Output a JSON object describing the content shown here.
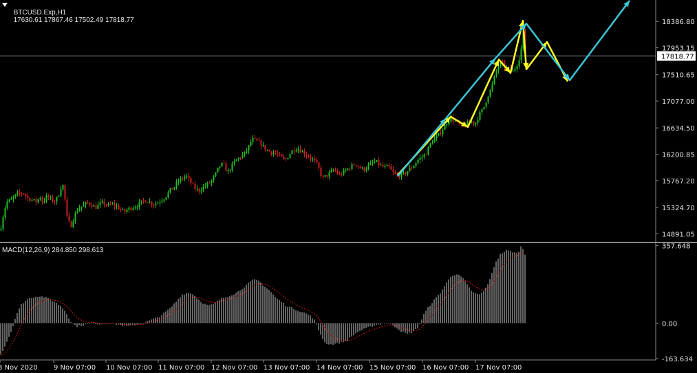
{
  "header": {
    "symbol": "BTCUSD.Exp,H1",
    "ohlc": "17630.61 17867.46 17502.49 17818.77"
  },
  "macd_header": {
    "label": "MACD(12,26,9) 284.850 298.613"
  },
  "colors": {
    "background": "#000000",
    "bull": "#1fbf1f",
    "bear": "#cc1f1f",
    "wave_primary": "#3cc7d8",
    "wave_secondary": "#ffff22",
    "histogram": "#c8c8c8",
    "signal": "#d21a1a",
    "grid": "#8a8a8a"
  },
  "chart_data": [
    {
      "type": "candlestick",
      "yticks": [
        "18386.80",
        "17953.15",
        "17510.65",
        "17077.00",
        "16634.50",
        "16200.85",
        "15767.20",
        "15324.70",
        "14891.05"
      ],
      "yrange": [
        14760,
        18740
      ],
      "current_price": "17818.77",
      "xticks": [
        "8 Nov 2020",
        "9 Nov 07:00",
        "10 Nov 07:00",
        "11 Nov 07:00",
        "12 Nov 07:00",
        "13 Nov 07:00",
        "14 Nov 07:00",
        "15 Nov 07:00",
        "16 Nov 07:00",
        "17 Nov 07:00"
      ],
      "close_path": [
        [
          0,
          14950
        ],
        [
          6,
          15300
        ],
        [
          10,
          15420
        ],
        [
          16,
          15450
        ],
        [
          22,
          15520
        ],
        [
          28,
          15560
        ],
        [
          34,
          15560
        ],
        [
          40,
          15480
        ],
        [
          46,
          15450
        ],
        [
          52,
          15420
        ],
        [
          58,
          15500
        ],
        [
          62,
          15400
        ],
        [
          66,
          15500
        ],
        [
          72,
          15480
        ],
        [
          78,
          15420
        ],
        [
          84,
          15500
        ],
        [
          88,
          15650
        ],
        [
          92,
          15700
        ],
        [
          96,
          15200
        ],
        [
          102,
          15000
        ],
        [
          108,
          15200
        ],
        [
          114,
          15320
        ],
        [
          120,
          15350
        ],
        [
          126,
          15400
        ],
        [
          132,
          15380
        ],
        [
          138,
          15320
        ],
        [
          144,
          15380
        ],
        [
          150,
          15400
        ],
        [
          156,
          15350
        ],
        [
          162,
          15380
        ],
        [
          168,
          15350
        ],
        [
          174,
          15300
        ],
        [
          180,
          15250
        ],
        [
          186,
          15300
        ],
        [
          192,
          15330
        ],
        [
          198,
          15350
        ],
        [
          204,
          15400
        ],
        [
          210,
          15450
        ],
        [
          216,
          15420
        ],
        [
          222,
          15380
        ],
        [
          228,
          15400
        ],
        [
          234,
          15450
        ],
        [
          240,
          15500
        ],
        [
          246,
          15600
        ],
        [
          252,
          15650
        ],
        [
          258,
          15750
        ],
        [
          264,
          15800
        ],
        [
          270,
          15850
        ],
        [
          276,
          15750
        ],
        [
          282,
          15650
        ],
        [
          288,
          15600
        ],
        [
          294,
          15650
        ],
        [
          300,
          15700
        ],
        [
          306,
          15750
        ],
        [
          312,
          15850
        ],
        [
          318,
          16000
        ],
        [
          324,
          16050
        ],
        [
          330,
          15900
        ],
        [
          336,
          16000
        ],
        [
          342,
          16100
        ],
        [
          348,
          16150
        ],
        [
          354,
          16200
        ],
        [
          360,
          16300
        ],
        [
          366,
          16450
        ],
        [
          372,
          16420
        ],
        [
          378,
          16380
        ],
        [
          384,
          16300
        ],
        [
          390,
          16250
        ],
        [
          396,
          16230
        ],
        [
          402,
          16200
        ],
        [
          408,
          16150
        ],
        [
          414,
          16100
        ],
        [
          420,
          16200
        ],
        [
          426,
          16280
        ],
        [
          432,
          16300
        ],
        [
          438,
          16250
        ],
        [
          444,
          16200
        ],
        [
          450,
          16150
        ],
        [
          456,
          16100
        ],
        [
          462,
          16000
        ],
        [
          468,
          15800
        ],
        [
          474,
          15850
        ],
        [
          480,
          15900
        ],
        [
          486,
          15950
        ],
        [
          492,
          15850
        ],
        [
          498,
          15900
        ],
        [
          504,
          15950
        ],
        [
          510,
          16000
        ],
        [
          516,
          16050
        ],
        [
          522,
          15980
        ],
        [
          528,
          15950
        ],
        [
          534,
          16000
        ],
        [
          540,
          16050
        ],
        [
          546,
          16080
        ],
        [
          552,
          16020
        ],
        [
          558,
          15980
        ],
        [
          564,
          16000
        ],
        [
          570,
          15900
        ],
        [
          576,
          15850
        ],
        [
          582,
          15860
        ],
        [
          588,
          15880
        ],
        [
          594,
          15950
        ],
        [
          600,
          16000
        ],
        [
          606,
          16100
        ],
        [
          612,
          16150
        ],
        [
          618,
          16200
        ],
        [
          624,
          16350
        ],
        [
          630,
          16450
        ],
        [
          636,
          16500
        ],
        [
          642,
          16600
        ],
        [
          648,
          16700
        ],
        [
          654,
          16800
        ],
        [
          660,
          16750
        ],
        [
          666,
          16700
        ],
        [
          672,
          16650
        ],
        [
          678,
          16700
        ],
        [
          684,
          16750
        ],
        [
          690,
          16700
        ],
        [
          696,
          16850
        ],
        [
          702,
          16950
        ],
        [
          708,
          17150
        ],
        [
          714,
          17300
        ],
        [
          720,
          17550
        ],
        [
          726,
          17700
        ],
        [
          732,
          17650
        ],
        [
          738,
          17600
        ],
        [
          744,
          17550
        ],
        [
          750,
          17650
        ],
        [
          756,
          17850
        ],
        [
          760,
          18200
        ],
        [
          763,
          17820
        ]
      ]
    },
    {
      "type": "macd",
      "yticks": [
        "357.648",
        "0.00",
        "-163.634"
      ],
      "yrange": [
        -170,
        362
      ],
      "hist": [
        [
          0,
          -150
        ],
        [
          8,
          -100
        ],
        [
          16,
          -40
        ],
        [
          24,
          40
        ],
        [
          32,
          90
        ],
        [
          40,
          110
        ],
        [
          48,
          120
        ],
        [
          56,
          125
        ],
        [
          64,
          120
        ],
        [
          72,
          110
        ],
        [
          80,
          95
        ],
        [
          88,
          80
        ],
        [
          96,
          50
        ],
        [
          104,
          0
        ],
        [
          112,
          -15
        ],
        [
          120,
          -10
        ],
        [
          128,
          -5
        ],
        [
          136,
          0
        ],
        [
          144,
          -5
        ],
        [
          152,
          0
        ],
        [
          160,
          0
        ],
        [
          168,
          -5
        ],
        [
          176,
          -10
        ],
        [
          184,
          -15
        ],
        [
          192,
          -10
        ],
        [
          200,
          -5
        ],
        [
          208,
          0
        ],
        [
          216,
          10
        ],
        [
          224,
          20
        ],
        [
          232,
          30
        ],
        [
          240,
          50
        ],
        [
          248,
          70
        ],
        [
          256,
          100
        ],
        [
          264,
          130
        ],
        [
          272,
          140
        ],
        [
          280,
          135
        ],
        [
          288,
          110
        ],
        [
          296,
          90
        ],
        [
          304,
          80
        ],
        [
          312,
          90
        ],
        [
          320,
          110
        ],
        [
          328,
          120
        ],
        [
          336,
          130
        ],
        [
          344,
          140
        ],
        [
          352,
          160
        ],
        [
          360,
          180
        ],
        [
          368,
          200
        ],
        [
          376,
          195
        ],
        [
          384,
          170
        ],
        [
          392,
          150
        ],
        [
          400,
          120
        ],
        [
          408,
          100
        ],
        [
          416,
          80
        ],
        [
          424,
          70
        ],
        [
          432,
          60
        ],
        [
          440,
          50
        ],
        [
          448,
          40
        ],
        [
          456,
          20
        ],
        [
          464,
          -40
        ],
        [
          472,
          -90
        ],
        [
          480,
          -100
        ],
        [
          488,
          -95
        ],
        [
          496,
          -90
        ],
        [
          504,
          -80
        ],
        [
          512,
          -60
        ],
        [
          520,
          -40
        ],
        [
          528,
          -30
        ],
        [
          536,
          -20
        ],
        [
          544,
          -10
        ],
        [
          552,
          -5
        ],
        [
          560,
          0
        ],
        [
          568,
          -5
        ],
        [
          576,
          -20
        ],
        [
          584,
          -40
        ],
        [
          592,
          -50
        ],
        [
          600,
          -40
        ],
        [
          608,
          -20
        ],
        [
          616,
          40
        ],
        [
          624,
          80
        ],
        [
          632,
          110
        ],
        [
          640,
          140
        ],
        [
          648,
          180
        ],
        [
          656,
          220
        ],
        [
          664,
          225
        ],
        [
          672,
          210
        ],
        [
          680,
          170
        ],
        [
          688,
          140
        ],
        [
          696,
          130
        ],
        [
          704,
          150
        ],
        [
          712,
          200
        ],
        [
          720,
          280
        ],
        [
          728,
          320
        ],
        [
          736,
          335
        ],
        [
          744,
          330
        ],
        [
          752,
          320
        ],
        [
          758,
          358
        ],
        [
          764,
          310
        ]
      ]
    }
  ]
}
